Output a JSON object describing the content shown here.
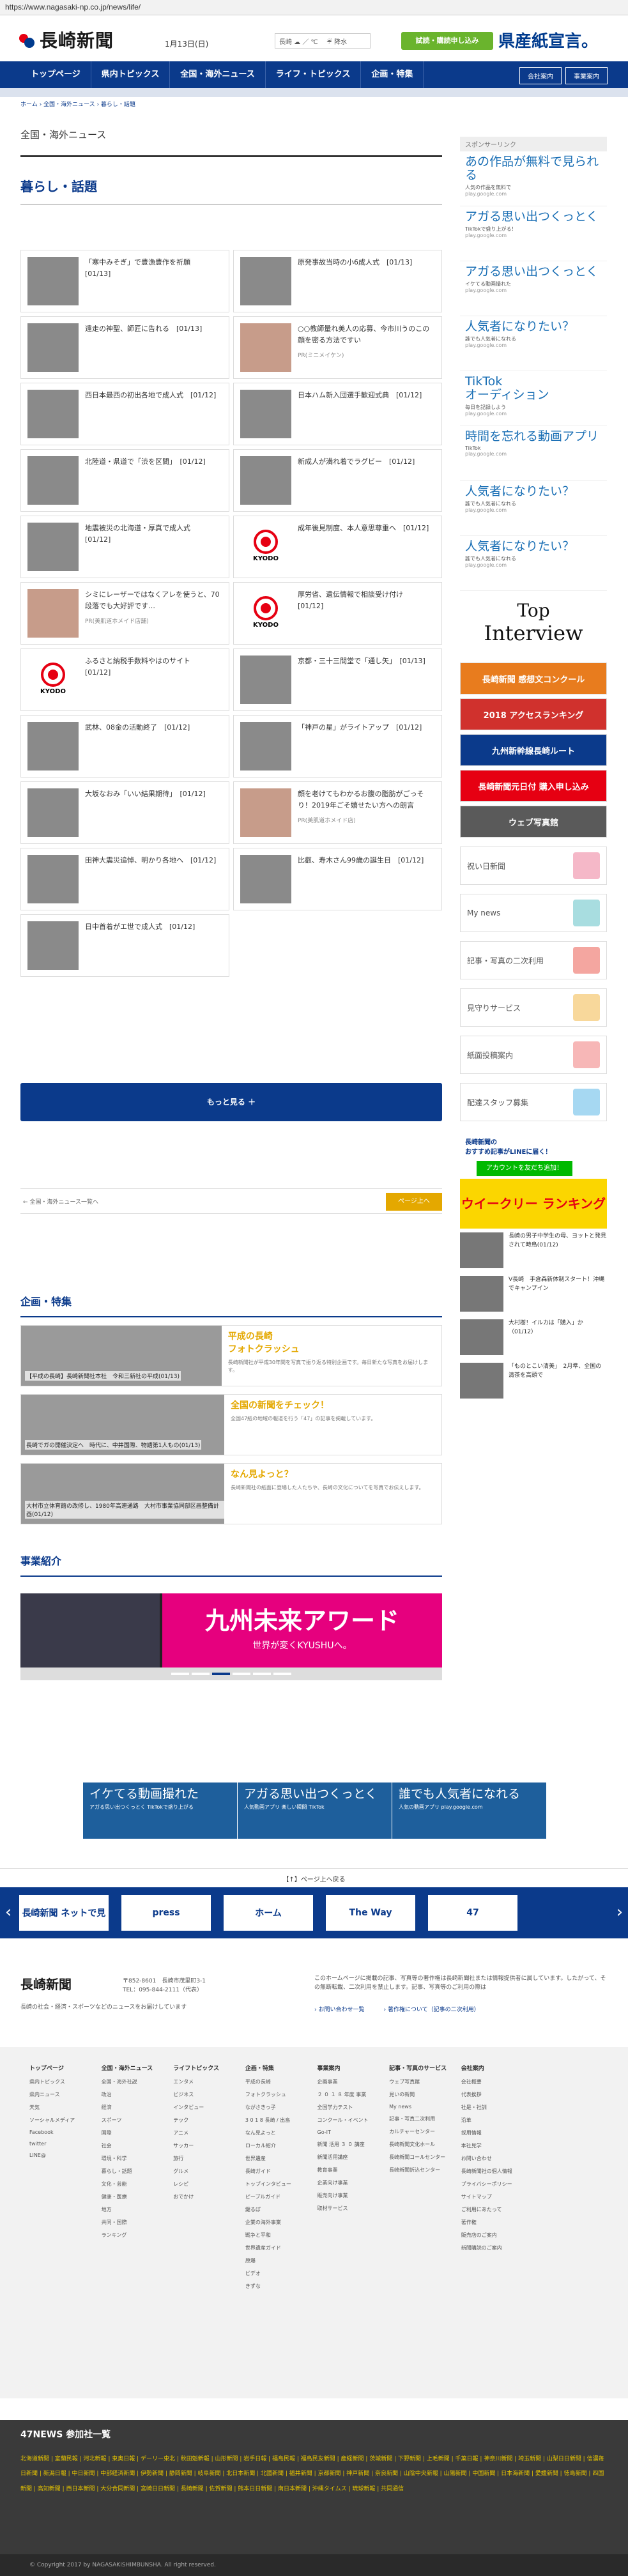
{
  "url": "https://www.nagasaki-np.co.jp/news/life/",
  "header": {
    "logo": "長崎新聞",
    "date": "1月13日(日)",
    "weather": "長崎 ☁ ／ ℃ 　☔ 降水",
    "trial": "試読・購読申し込み",
    "kenzan": "県産紙宣言。"
  },
  "nav": {
    "items": [
      "トップページ",
      "県内トピックス",
      "全国・海外ニュース",
      "ライフ・トピックス",
      "企画・特集"
    ],
    "right": [
      "会社案内",
      "事業案内"
    ]
  },
  "breadcrumb": "ホーム › 全国・海外ニュース › 暮らし・話題",
  "main": {
    "category": "全国・海外ニュース",
    "section": "暮らし・話題",
    "more": "もっと見る ＋",
    "back": "← 全国・海外ニュース一覧へ",
    "pagetop": "ページ上へ"
  },
  "articles": [
    {
      "title": "「寒中みそぎ」で豊漁豊作を祈願　[01/13]",
      "sub": "",
      "kyodo": false
    },
    {
      "title": "原発事故当時の小6成人式　[01/13]",
      "sub": "",
      "kyodo": false
    },
    {
      "title": "遠走の神聖、師匠に告れる　[01/13]",
      "sub": "",
      "kyodo": false
    },
    {
      "title": "○○教師量れ美人の応募、今市川うのこの顔を密る方法ですい",
      "sub": "PR(ミニメイケン)",
      "kyodo": false
    },
    {
      "title": "西日本最西の初出各地で成人式　[01/12]",
      "sub": "",
      "kyodo": false
    },
    {
      "title": "日本ハム新入団選手歓迎式典　[01/12]",
      "sub": "",
      "kyodo": false
    },
    {
      "title": "北陸道・県道で「渋を区間」　[01/12]",
      "sub": "",
      "kyodo": false
    },
    {
      "title": "新成人が満れ着でラグビー　[01/12]",
      "sub": "",
      "kyodo": false
    },
    {
      "title": "地震被災の北海道・厚真で成人式　[01/12]",
      "sub": "",
      "kyodo": false
    },
    {
      "title": "成年後見制度、本人意思尊重へ　[01/12]",
      "sub": "",
      "kyodo": true
    },
    {
      "title": "シミにレーザーではなくアレを使うと、70段落でも大好評です…",
      "sub": "PR(美肌道ホメイド店舗)",
      "kyodo": false
    },
    {
      "title": "厚労省、遺伝情報で相談受け付け　[01/12]",
      "sub": "",
      "kyodo": true
    },
    {
      "title": "ふるさと納税手数料やはのサイト　[01/12]",
      "sub": "",
      "kyodo": true
    },
    {
      "title": "京都・三十三間堂で「通し矢」　[01/13]",
      "sub": "",
      "kyodo": false
    },
    {
      "title": "武林、08金の活動終了　[01/12]",
      "sub": "",
      "kyodo": false
    },
    {
      "title": "「神戸の星」がライトアップ　[01/12]",
      "sub": "",
      "kyodo": false
    },
    {
      "title": "大坂なおみ「いい結果期待」　[01/12]",
      "sub": "",
      "kyodo": false
    },
    {
      "title": "顔を老けてもわかるお腹の脂肪がごっそり！2019年ごそ嬉せたい方への朗言",
      "sub": "PR(美肌道ホメイド店)",
      "kyodo": false
    },
    {
      "title": "田神大震災追悼、明かり各地へ　[01/12]",
      "sub": "",
      "kyodo": false
    },
    {
      "title": "比叡、寿木さん99歳の誕生日　[01/12]",
      "sub": "",
      "kyodo": false
    },
    {
      "title": "日中首着がエ世で成人式　[01/12]",
      "sub": "",
      "kyodo": false
    }
  ],
  "kikaku": {
    "heading": "企画・特集",
    "items": [
      {
        "title": "平成の長崎\nフォトクラッシュ",
        "desc": "長崎新聞社が平成30年間を写真で振り返る特別企画です。毎日新たな写真をお届けします。",
        "cap": "【平成の長崎】長崎新聞社本社　令和三新社の平成(01/13)"
      },
      {
        "title": "全国の新聞をチェック！",
        "desc": "全国47紙の地域の報道を行う「47」の記事を掲載しています。",
        "cap": "長崎でガの開催決定へ　時代に、中井国際、物語第1人もの(01/13)"
      },
      {
        "title": "なん見よっと？",
        "desc": "長崎新聞社の紙面に登場した人たちや、長崎の文化についてを写真でお伝えします。",
        "cap": "大村市立体育館の改修し、1980年高速通路　大村市事業協同部区画整備計画(01/12)"
      }
    ]
  },
  "jigyo": {
    "heading": "事業紹介",
    "banner_big": "九州未来アワード",
    "banner_small": "世界が変くKYUSHUへ。"
  },
  "sidebar": {
    "sponsor": "スポンサーリンク",
    "ads": [
      {
        "title": "あの作品が無料で見られる",
        "sub": "人気の作品を無料で",
        "url": "play.google.com"
      },
      {
        "title": "アガる思い出つくっとく",
        "sub": "TikTokで盛り上がる！",
        "url": "play.google.com"
      },
      {
        "title": "アガる思い出つくっとく",
        "sub": "イケてる動画撮れた",
        "url": "play.google.com"
      },
      {
        "title": "人気者になりたい？",
        "sub": "誰でも人気者になれる",
        "url": "play.google.com"
      },
      {
        "title": "TikTok\nオーディション",
        "sub": "毎日を記録しよう",
        "url": "play.google.com"
      },
      {
        "title": "時間を忘れる動画アプリ",
        "sub": "TikTok",
        "url": "play.google.com"
      },
      {
        "title": "人気者になりたい？",
        "sub": "誰でも人気者になれる",
        "url": "play.google.com"
      },
      {
        "title": "人気者になりたい？",
        "sub": "誰でも人気者になれる",
        "url": "play.google.com"
      }
    ],
    "interview_top": "Top",
    "interview_main": "Interview",
    "banners": [
      {
        "label": "長崎新聞 感想文コンクール",
        "color": "#e87c1e"
      },
      {
        "label": "2018 アクセスランキング",
        "color": "#d0312d"
      },
      {
        "label": "九州新幹線長崎ルート",
        "color": "#0b3a8b"
      },
      {
        "label": "長崎新聞元日付 購入申し込み",
        "color": "#e60012"
      },
      {
        "label": "ウェブ写真館",
        "color": "#5a5a5a"
      }
    ],
    "services": [
      {
        "label": "祝い日新聞",
        "color": "#f5b8c8"
      },
      {
        "label": "My news",
        "color": "#a8dde0"
      },
      {
        "label": "記事・写真の二次利用",
        "color": "#f4a6a0"
      },
      {
        "label": "見守りサービス",
        "color": "#f8d89b"
      },
      {
        "label": "紙面投稿案内",
        "color": "#f7b7b7"
      },
      {
        "label": "配達スタッフ募集",
        "color": "#a6d8f2"
      }
    ],
    "line_title": "長崎新聞の\nおすすめ記事がLINEに届く！",
    "line_btn": "アカウントを友だち追加！",
    "weekly": "ウイークリー ランキング",
    "popular": [
      "長崎の男子中学生の母、ヨットと発見されて時鳥(01/12)",
      "V長崎　手倉森新体制スタート！沖縄でキャンプイン",
      "大村樹！イルカは「購入」か（01/12）",
      "「ものとこい清美」　2月準、全国の清茶を高頭で"
    ]
  },
  "adbar": [
    {
      "big": "イケてる動画撮れた",
      "sm": "アガる思い出つくっとく TikTokで盛り上がる"
    },
    {
      "big": "アガる思い出つくっとく",
      "sm": "人気動画アプリ 楽しい瞬間 TikTok"
    },
    {
      "big": "誰でも人気者になれる",
      "sm": "人気の動画アプリ play.google.com"
    }
  ],
  "pagejump": "【↑】ページ上へ戻る",
  "carousel": [
    "長崎新聞 ネットで見",
    "press",
    "ホーム",
    "The Way",
    "47"
  ],
  "footer": {
    "logo": "長崎新聞",
    "addr": "〒852-8601　長崎市茂里町3-1\nTEL：095-844-2111（代表）",
    "desc": "長崎の社会・経済・スポーツなどのニュースをお届けしています",
    "note": "このホームページに掲載の記事、写真等の著作権は長崎新聞社または情報提供者に属しています。したがって、その無断転載、二次利用を禁止します。記事、写真等のご利用の際は",
    "links": [
      "› お問い合わせ一覧",
      "› 著作権について（記事の二次利用）"
    ]
  },
  "sitemap": [
    {
      "h": "トップページ",
      "l": [
        "県内トピックス",
        "県内ニュース",
        "天気",
        "ソーシャルメディア",
        "Facebook",
        "twitter",
        "LINE@"
      ]
    },
    {
      "h": "全国・海外ニュース",
      "l": [
        "全国・海外社説",
        "政治",
        "経済",
        "スポーツ",
        "国際",
        "社会",
        "環境・科学",
        "暮らし・話題",
        "文化・芸能",
        "健康・医療",
        "地方",
        "共同・国際",
        "ランキング"
      ]
    },
    {
      "h": "ライフトピックス",
      "l": [
        "エンタメ",
        "ビジネス",
        "インタビュー",
        "テック",
        "アニメ",
        "サッカー",
        "旅行",
        "グルメ",
        "レシピ",
        "おでかけ"
      ]
    },
    {
      "h": "企画・特集",
      "l": [
        "平成の長崎",
        "フォトクラッシュ",
        "ながさきっ子",
        "3 0 1 8 長崎 / 出島",
        "なん見よっと",
        "ローカル紹介",
        "世界遺産",
        "長崎ガイド",
        "トップインタビュー",
        "ピープルガイド",
        "鍵るぽ",
        "企業の海外事業",
        "戦争と平和",
        "世界遺産ガイド",
        "原爆",
        "ビデオ",
        "きずな"
      ]
    },
    {
      "h": "事業案内",
      "l": [
        "企画事業",
        "２ ０ １ ８ 年度 事業",
        "全国学力テスト",
        "コンクール・イベント",
        "Go-IT",
        "新聞 活用 ３ ０ 講座",
        "新聞活用講座",
        "教育事業",
        "企業向け事業",
        "販売向け事業",
        "取材サービス"
      ]
    },
    {
      "h": "記事・写真のサービス",
      "l": [
        "ウェブ写真館",
        "見いの新聞",
        "My news",
        "記事・写真二次利用",
        "カルチャーセンター",
        "長崎新聞文化ホール",
        "長崎新聞コールセンター",
        "長崎新聞折込センター"
      ]
    },
    {
      "h": "会社案内",
      "l": [
        "会社概要",
        "代表挨拶",
        "社是・社訓",
        "沿革",
        "採用情報",
        "本社見学",
        "お問い合わせ",
        "長崎新聞社の個人情報",
        "プライバシーポリシー",
        "サイトマップ",
        "ご利用にあたって",
        "著作権",
        "販売店のご案内",
        "新聞購読のご案内"
      ]
    },
    {
      "h": "",
      "l": []
    }
  ],
  "n47": {
    "heading": "47NEWS 参加社一覧",
    "list": "北海道新聞 | 室蘭民報 | 河北新報 | 東奥日報 | デーリー東北 | 秋田魁新報 | 山形新聞 | 岩手日報 | 福島民報 | 福島民友新聞 | 産経新聞 | 茨城新聞 | 下野新聞 | 上毛新聞 | 千葉日報 | 神奈川新聞 | 埼玉新聞 | 山梨日日新聞 | 信濃毎日新聞 | 新潟日報 | 中日新聞 | 中部経済新聞 | 伊勢新聞 | 静岡新聞 | 岐阜新聞 | 北日本新聞 | 北國新聞 | 福井新聞 | 京都新聞 | 神戸新聞 | 奈良新聞 | 山陰中央新報 | 山陽新聞 | 中国新聞 | 日本海新聞 | 愛媛新聞 | 徳島新聞 | 四国新聞 | 高知新聞 | 西日本新聞 | 大分合同新聞 | 宮崎日日新聞 | 長崎新聞 | 佐賀新聞 | 熊本日日新聞 | 南日本新聞 | 沖縄タイムス | 琉球新報 | 共同通信"
  },
  "copyright": "© Copyright 2017 by NAGASAKISHIMBUNSHA. All right reserved."
}
